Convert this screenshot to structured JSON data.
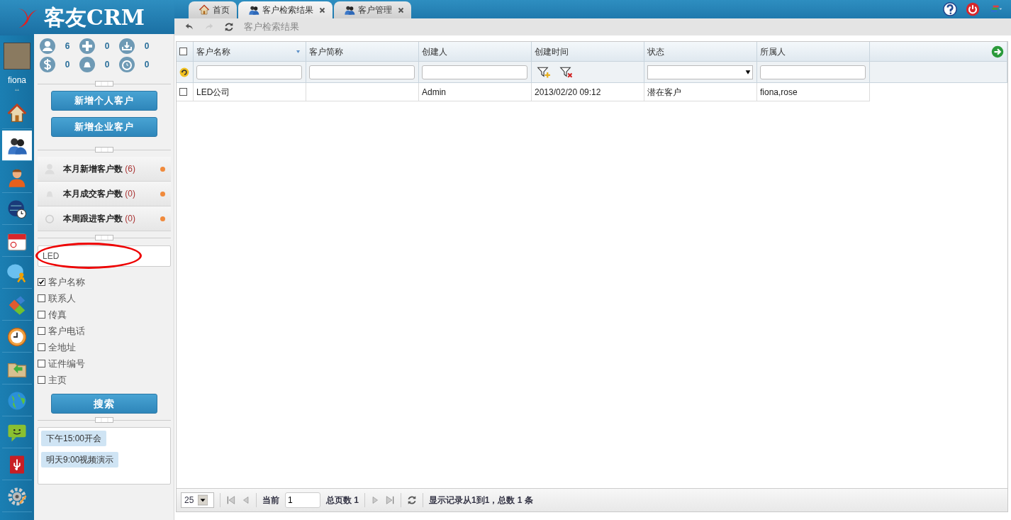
{
  "logo": {
    "text": "客友CRM"
  },
  "tabs": [
    {
      "label": "首页",
      "closable": false,
      "selected": false
    },
    {
      "label": "客户检索结果",
      "closable": true,
      "selected": true
    },
    {
      "label": "客户管理",
      "closable": true,
      "selected": false
    }
  ],
  "toolbar": {
    "title": "客户检索结果"
  },
  "user": {
    "name": "fiona"
  },
  "rail": [
    {
      "kind": "home",
      "selected": false
    },
    {
      "kind": "people",
      "selected": true
    },
    {
      "kind": "person",
      "selected": false
    },
    {
      "kind": "globe-clock",
      "selected": false
    },
    {
      "kind": "calendar",
      "selected": false
    },
    {
      "kind": "chat",
      "selected": false
    },
    {
      "kind": "blocks",
      "selected": false
    },
    {
      "kind": "clock",
      "selected": false
    },
    {
      "kind": "folder",
      "selected": false
    },
    {
      "kind": "globe",
      "selected": false
    },
    {
      "kind": "message",
      "selected": false
    },
    {
      "kind": "usb",
      "selected": false
    },
    {
      "kind": "settings",
      "selected": false
    }
  ],
  "stats": [
    {
      "kind": "person",
      "value": "6"
    },
    {
      "kind": "plus",
      "value": "0"
    },
    {
      "kind": "download",
      "value": "0"
    },
    {
      "kind": "dollar",
      "value": "0"
    },
    {
      "kind": "bell",
      "value": "0"
    },
    {
      "kind": "alarm",
      "value": "0"
    }
  ],
  "action_buttons": [
    "新增个人客户",
    "新增企业客户"
  ],
  "summaries": [
    {
      "kind": "person",
      "label": "本月新增客户数",
      "count": "(6)"
    },
    {
      "kind": "bell",
      "label": "本月成交客户数",
      "count": "(0)"
    },
    {
      "kind": "alarm",
      "label": "本周跟进客户数",
      "count": "(0)"
    }
  ],
  "search": {
    "value": "LED",
    "circled": true
  },
  "search_fields": [
    {
      "label": "客户名称",
      "checked": true
    },
    {
      "label": "联系人",
      "checked": false
    },
    {
      "label": "传真",
      "checked": false
    },
    {
      "label": "客户电话",
      "checked": false
    },
    {
      "label": "全地址",
      "checked": false
    },
    {
      "label": "证件编号",
      "checked": false
    },
    {
      "label": "主页",
      "checked": false
    }
  ],
  "search_button": "搜索",
  "notes": [
    "下午15:00开会",
    "明天9:00视频演示"
  ],
  "table": {
    "all_checked": false,
    "columns": [
      {
        "label": "客户名称",
        "sorted": true,
        "kind": "text"
      },
      {
        "label": "客户简称",
        "sorted": false,
        "kind": "text"
      },
      {
        "label": "创建人",
        "sorted": false,
        "kind": "text"
      },
      {
        "label": "创建时间",
        "sorted": false,
        "kind": "buttons"
      },
      {
        "label": "状态",
        "sorted": false,
        "kind": "select"
      },
      {
        "label": "所属人",
        "sorted": false,
        "kind": "text"
      }
    ],
    "rows": [
      {
        "checked": false,
        "cells": [
          "LED公司",
          "",
          "Admin",
          "2013/02/20 09:12",
          "潜在客户",
          "fiona,rose"
        ]
      }
    ]
  },
  "pager": {
    "page_size": "25",
    "current_label": "当前",
    "page": "1",
    "total": "总页数 1",
    "info": "显示记录从1到1，总数 1 条"
  }
}
